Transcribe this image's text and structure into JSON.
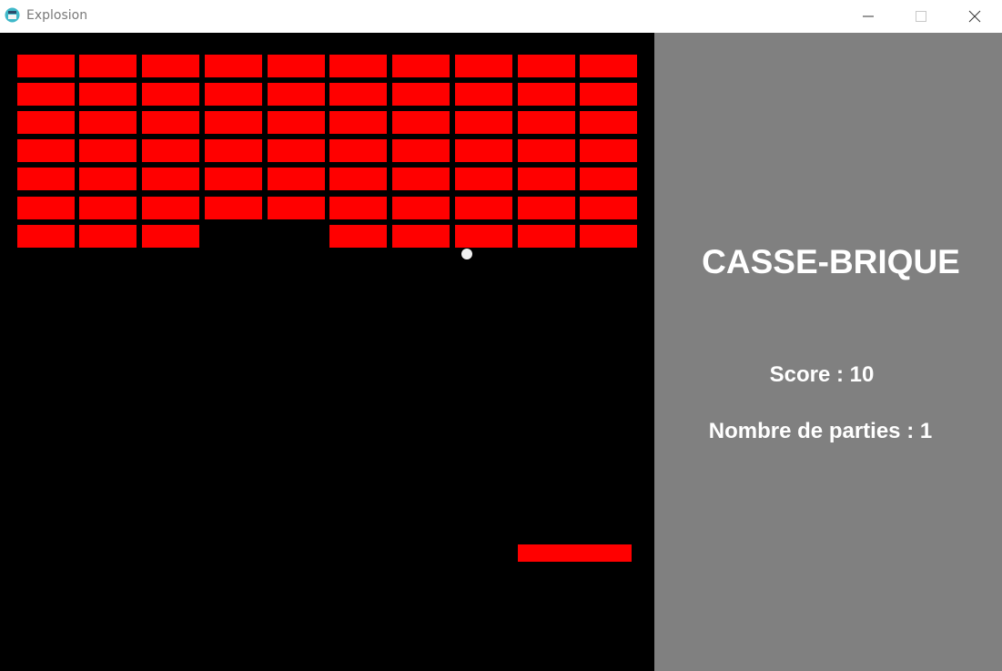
{
  "window": {
    "title": "Explosion",
    "icon": "app-icon"
  },
  "controls": {
    "minimize_icon": "minimize-icon",
    "maximize_icon": "maximize-icon",
    "close_icon": "close-icon"
  },
  "game": {
    "background_color": "#000000",
    "brick_color": "#ff0000",
    "ball_color": "#f0f0f0",
    "paddle_color": "#ff0000",
    "brick_rows": 7,
    "brick_columns": 10,
    "destroyed_bricks": [
      {
        "row": 7,
        "col": 4
      },
      {
        "row": 7,
        "col": 5
      }
    ]
  },
  "panel": {
    "background_color": "#808080",
    "title": "CASSE-BRIQUE",
    "score": "Score : 10",
    "games_count": "Nombre de parties : 1"
  }
}
